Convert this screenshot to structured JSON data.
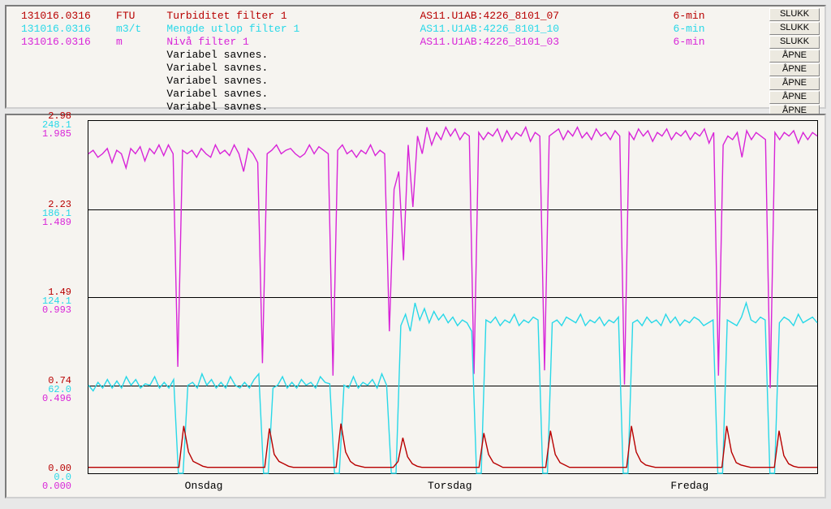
{
  "header": {
    "rows": [
      {
        "ts": "131016.0316",
        "unit": "FTU",
        "desc": "Turbiditet filter 1",
        "tag": "AS11.U1AB:4226_8101_07",
        "res": "6-min",
        "color": "c-red"
      },
      {
        "ts": "131016.0316",
        "unit": "m3/t",
        "desc": "Mengde utlop filter 1",
        "tag": "AS11.U1AB:4226_8101_10",
        "res": "6-min",
        "color": "c-cyan"
      },
      {
        "ts": "131016.0316",
        "unit": "m",
        "desc": "Nivå filter 1",
        "tag": "AS11.U1AB:4226_8101_03",
        "res": "6-min",
        "color": "c-mag"
      }
    ],
    "missing": [
      "Variabel savnes.",
      "Variabel savnes.",
      "Variabel savnes.",
      "Variabel savnes.",
      "Variabel savnes."
    ],
    "buttons": [
      "SLUKK",
      "SLUKK",
      "SLUKK",
      "ÅPNE",
      "ÅPNE",
      "ÅPNE",
      "ÅPNE",
      "ÅPNE"
    ]
  },
  "chart_data": {
    "type": "line",
    "x_days": [
      "Onsdag",
      "Torsdag",
      "Fredag"
    ],
    "y_axes": [
      {
        "color": "c-red",
        "ticks": [
          2.98,
          2.23,
          1.49,
          0.74,
          0.0
        ],
        "range": [
          0.0,
          2.98
        ]
      },
      {
        "color": "c-cyan",
        "ticks": [
          248.1,
          186.1,
          124.1,
          62.0,
          0.0
        ],
        "range": [
          0.0,
          248.1
        ]
      },
      {
        "color": "c-mag",
        "ticks": [
          1.985,
          1.489,
          0.993,
          0.496,
          0.0
        ],
        "range": [
          0.0,
          1.985
        ]
      }
    ],
    "gridlines_y_fraction": [
      0.0,
      0.25,
      0.5,
      0.75,
      1.0
    ],
    "series": [
      {
        "name": "Nivå filter 1",
        "axis": 2,
        "color": "#d824d8",
        "values": [
          1.8,
          1.82,
          1.78,
          1.8,
          1.83,
          1.75,
          1.82,
          1.8,
          1.72,
          1.83,
          1.8,
          1.84,
          1.76,
          1.83,
          1.8,
          1.85,
          1.79,
          1.85,
          1.8,
          0.6,
          1.82,
          1.8,
          1.82,
          1.78,
          1.83,
          1.8,
          1.78,
          1.85,
          1.8,
          1.82,
          1.79,
          1.85,
          1.8,
          1.7,
          1.83,
          1.8,
          1.75,
          0.62,
          1.8,
          1.82,
          1.85,
          1.8,
          1.82,
          1.83,
          1.8,
          1.78,
          1.8,
          1.85,
          1.8,
          1.84,
          1.82,
          1.8,
          0.55,
          1.82,
          1.85,
          1.8,
          1.82,
          1.78,
          1.82,
          1.8,
          1.85,
          1.79,
          1.82,
          1.8,
          0.8,
          1.6,
          1.7,
          1.2,
          1.85,
          1.5,
          1.9,
          1.8,
          1.95,
          1.85,
          1.92,
          1.88,
          1.95,
          1.9,
          1.94,
          1.88,
          1.92,
          1.9,
          0.56,
          1.92,
          1.88,
          1.92,
          1.9,
          1.94,
          1.87,
          1.93,
          1.88,
          1.92,
          1.9,
          1.95,
          1.87,
          1.92,
          1.9,
          0.58,
          1.9,
          1.92,
          1.94,
          1.88,
          1.93,
          1.9,
          1.95,
          1.89,
          1.92,
          1.88,
          1.94,
          1.9,
          1.92,
          1.88,
          1.93,
          1.9,
          0.5,
          1.92,
          1.88,
          1.94,
          1.9,
          1.93,
          1.87,
          1.92,
          1.9,
          1.94,
          1.88,
          1.92,
          1.9,
          1.93,
          1.88,
          1.92,
          1.9,
          1.94,
          1.86,
          1.92,
          0.55,
          1.85,
          1.9,
          1.88,
          1.92,
          1.78,
          1.93,
          1.88,
          1.92,
          1.9,
          1.88,
          0.48,
          1.92,
          1.88,
          1.92,
          1.9,
          1.93,
          1.86,
          1.92,
          1.88,
          1.92,
          1.9
        ]
      },
      {
        "name": "Mengde utlop filter 1",
        "axis": 1,
        "color": "#28d8e8",
        "values": [
          62,
          58,
          64,
          60,
          66,
          60,
          65,
          60,
          68,
          62,
          66,
          60,
          63,
          62,
          68,
          60,
          64,
          60,
          66,
          0,
          0,
          62,
          64,
          60,
          70,
          62,
          66,
          60,
          64,
          60,
          68,
          62,
          60,
          64,
          60,
          66,
          70,
          0,
          0,
          60,
          62,
          68,
          60,
          64,
          60,
          66,
          62,
          64,
          60,
          68,
          64,
          63,
          0,
          0,
          62,
          60,
          68,
          60,
          64,
          62,
          66,
          60,
          70,
          62,
          0,
          0,
          104,
          112,
          100,
          120,
          108,
          116,
          106,
          114,
          108,
          112,
          106,
          110,
          104,
          108,
          106,
          100,
          0,
          0,
          108,
          106,
          110,
          104,
          108,
          106,
          112,
          104,
          108,
          106,
          110,
          108,
          0,
          0,
          106,
          108,
          104,
          110,
          108,
          106,
          112,
          104,
          108,
          106,
          110,
          104,
          108,
          106,
          110,
          0,
          0,
          106,
          108,
          104,
          110,
          106,
          108,
          104,
          112,
          106,
          110,
          104,
          108,
          106,
          110,
          108,
          104,
          106,
          108,
          0,
          0,
          108,
          106,
          104,
          110,
          120,
          108,
          106,
          110,
          108,
          0,
          0,
          106,
          110,
          108,
          104,
          112,
          106,
          108,
          110,
          106
        ]
      },
      {
        "name": "Turbiditet filter 1",
        "axis": 0,
        "color": "#b80000",
        "values": [
          0.05,
          0.05,
          0.05,
          0.05,
          0.05,
          0.05,
          0.05,
          0.05,
          0.05,
          0.05,
          0.05,
          0.05,
          0.05,
          0.05,
          0.05,
          0.05,
          0.05,
          0.05,
          0.05,
          0.05,
          0.4,
          0.18,
          0.1,
          0.08,
          0.06,
          0.05,
          0.05,
          0.05,
          0.05,
          0.05,
          0.05,
          0.05,
          0.05,
          0.05,
          0.05,
          0.05,
          0.05,
          0.05,
          0.38,
          0.16,
          0.1,
          0.08,
          0.06,
          0.05,
          0.05,
          0.05,
          0.05,
          0.05,
          0.05,
          0.05,
          0.05,
          0.05,
          0.05,
          0.42,
          0.18,
          0.1,
          0.07,
          0.06,
          0.05,
          0.05,
          0.05,
          0.05,
          0.05,
          0.05,
          0.05,
          0.1,
          0.3,
          0.14,
          0.08,
          0.06,
          0.05,
          0.05,
          0.05,
          0.05,
          0.05,
          0.05,
          0.05,
          0.05,
          0.05,
          0.05,
          0.05,
          0.05,
          0.05,
          0.34,
          0.16,
          0.09,
          0.07,
          0.05,
          0.05,
          0.05,
          0.05,
          0.05,
          0.05,
          0.05,
          0.05,
          0.05,
          0.05,
          0.36,
          0.16,
          0.09,
          0.07,
          0.05,
          0.05,
          0.05,
          0.05,
          0.05,
          0.05,
          0.05,
          0.05,
          0.05,
          0.05,
          0.05,
          0.05,
          0.05,
          0.4,
          0.18,
          0.1,
          0.07,
          0.06,
          0.05,
          0.05,
          0.05,
          0.05,
          0.05,
          0.05,
          0.05,
          0.05,
          0.05,
          0.05,
          0.05,
          0.05,
          0.05,
          0.05,
          0.05,
          0.4,
          0.18,
          0.09,
          0.07,
          0.06,
          0.05,
          0.05,
          0.05,
          0.05,
          0.05,
          0.05,
          0.36,
          0.15,
          0.08,
          0.06,
          0.05,
          0.05,
          0.05,
          0.05,
          0.05
        ]
      }
    ]
  }
}
